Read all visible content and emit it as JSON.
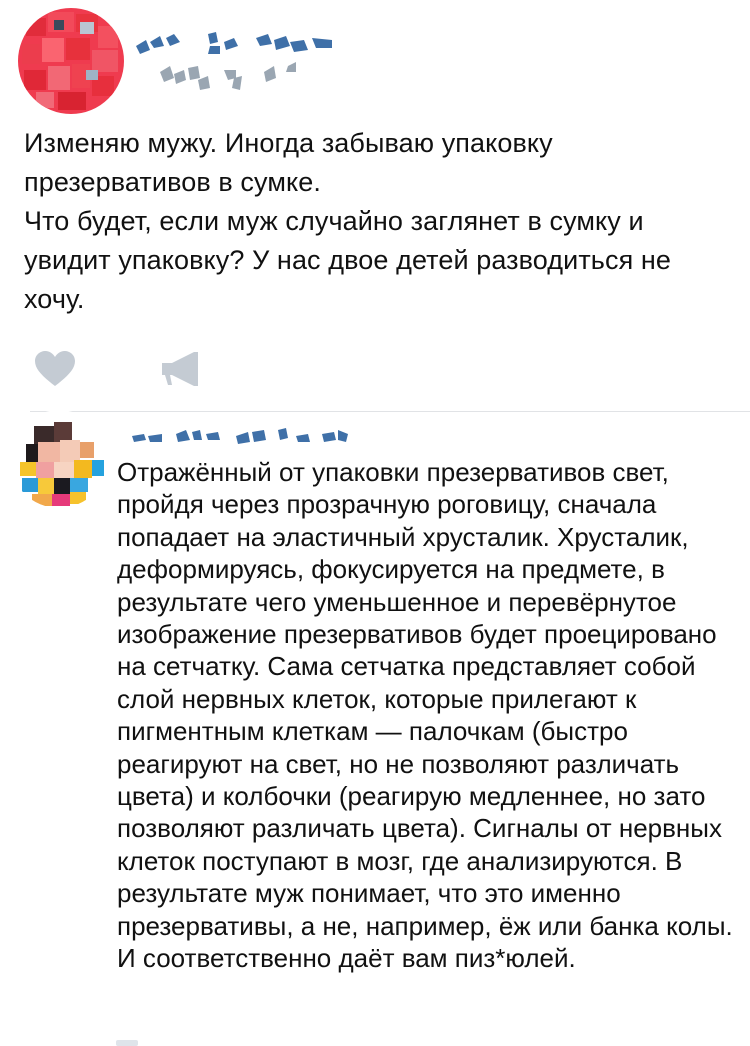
{
  "post": {
    "author_name": "",
    "text_line_1": "Изменяю мужу. Иногда забываю упаковку презервативов в сумке.",
    "text_line_2": "Что будет, если муж случайно заглянет в сумку и увидит упаковку? У нас двое детей разводиться не хочу.",
    "actions": {
      "like_icon": "heart-icon",
      "share_icon": "megaphone-icon"
    }
  },
  "comment": {
    "author_name": "",
    "text": "Отражённый от упаковки презервативов свет, пройдя через прозрачную роговицу, сначала попадает на эластичный хрусталик. Хрусталик, деформируясь, фокусируется на предмете, в результате чего уменьшенное и перевёрнутое изображение презервативов будет проецировано на сетчатку. Сама сетчатка представляет собой слой нервных клеток, которые прилегают к пигментным клеткам — палочкам (быстро реагируют на свет, но не позволяют различать цвета) и колбочки (реагирую медленнее, но зато позволяют различать цвета). Сигналы от нервных клеток поступают в мозг, где анализируются. В результате муж понимает, что это именно презервативы, а не, например, ёж или банка колы. И соответственно даёт вам пиз*юлей."
  },
  "colors": {
    "icon_gray": "#c4cbd3",
    "divider": "#e1e3e6",
    "text": "#111111"
  }
}
